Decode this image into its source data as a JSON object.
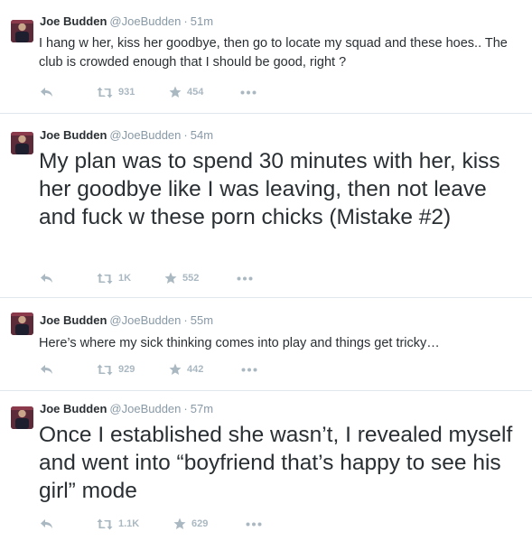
{
  "tweets": [
    {
      "author": "Joe Budden",
      "handle": "@JoeBudden",
      "sep": "·",
      "time": "51m",
      "text": "I hang w her, kiss her goodbye, then go to locate my squad and these hoes.. The club is crowded enough that I should be good, right ?",
      "retweets": "931",
      "favorites": "454"
    },
    {
      "author": "Joe Budden",
      "handle": "@JoeBudden",
      "sep": "·",
      "time": "54m",
      "text": "My plan was to spend 30 minutes with her, kiss her goodbye like I was leaving, then not leave and fuck w these porn chicks (Mistake #2)",
      "retweets": "1K",
      "favorites": "552"
    },
    {
      "author": "Joe Budden",
      "handle": "@JoeBudden",
      "sep": "·",
      "time": "55m",
      "text": "Here’s where my sick thinking comes into play and things get tricky…",
      "retweets": "929",
      "favorites": "442"
    },
    {
      "author": "Joe Budden",
      "handle": "@JoeBudden",
      "sep": "·",
      "time": "57m",
      "text": "Once I established she wasn’t, I revealed myself and went into “boyfriend that’s happy to see his girl” mode",
      "retweets": "1.1K",
      "favorites": "629"
    }
  ],
  "icons": {
    "reply": "reply-arrow",
    "retweet": "retweet-arrows",
    "favorite": "star",
    "more": "ellipsis"
  },
  "colors": {
    "name": "#292f33",
    "meta": "#8899a6",
    "action": "#aab8c2",
    "divider": "#e1e8ed"
  }
}
